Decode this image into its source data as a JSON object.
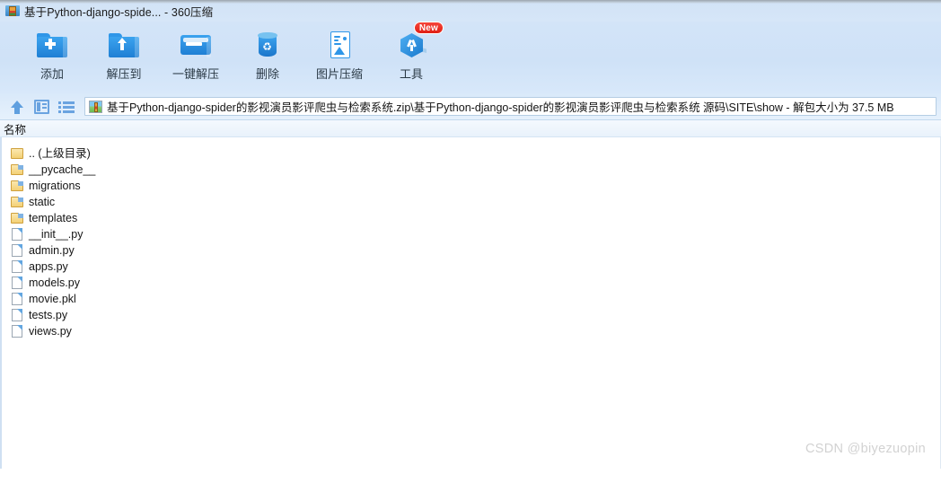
{
  "window": {
    "title": "基于Python-django-spide... - 360压缩",
    "app_icon": "archive-icon"
  },
  "toolbar": {
    "buttons": [
      {
        "label": "添加",
        "icon": "folder-add-icon",
        "badge": null
      },
      {
        "label": "解压到",
        "icon": "folder-extract-icon",
        "badge": null
      },
      {
        "label": "一键解压",
        "icon": "folder-onekey-icon",
        "badge": null
      },
      {
        "label": "删除",
        "icon": "trash-icon",
        "badge": null
      },
      {
        "label": "图片压缩",
        "icon": "image-compress-icon",
        "badge": null
      },
      {
        "label": "工具",
        "icon": "tools-cube-icon",
        "badge": "New"
      }
    ]
  },
  "addressbar": {
    "up_icon": "arrow-up-icon",
    "view_detail_icon": "view-detail-icon",
    "view_list_icon": "view-list-icon",
    "path_icon": "archive-file-icon",
    "path": "基于Python-django-spider的影视演员影评爬虫与检索系统.zip\\基于Python-django-spider的影视演员影评爬虫与检索系统 源码\\SITE\\show - 解包大小为 37.5 MB"
  },
  "columns": {
    "name": "名称"
  },
  "files": [
    {
      "name": ".. (上级目录)",
      "type": "parent"
    },
    {
      "name": "__pycache__",
      "type": "folder"
    },
    {
      "name": "migrations",
      "type": "folder"
    },
    {
      "name": "static",
      "type": "folder"
    },
    {
      "name": "templates",
      "type": "folder"
    },
    {
      "name": "__init__.py",
      "type": "file"
    },
    {
      "name": "admin.py",
      "type": "file"
    },
    {
      "name": "apps.py",
      "type": "file"
    },
    {
      "name": "models.py",
      "type": "file"
    },
    {
      "name": "movie.pkl",
      "type": "file"
    },
    {
      "name": "tests.py",
      "type": "file"
    },
    {
      "name": "views.py",
      "type": "file"
    }
  ],
  "watermark": "CSDN @biyezuopin",
  "colors": {
    "titlebar": "#d6e6f8",
    "toolbar": "#cfe2f7",
    "accent_blue": "#2f96e8",
    "badge_red": "#df1f14",
    "folder_yellow": "#f3d075"
  }
}
